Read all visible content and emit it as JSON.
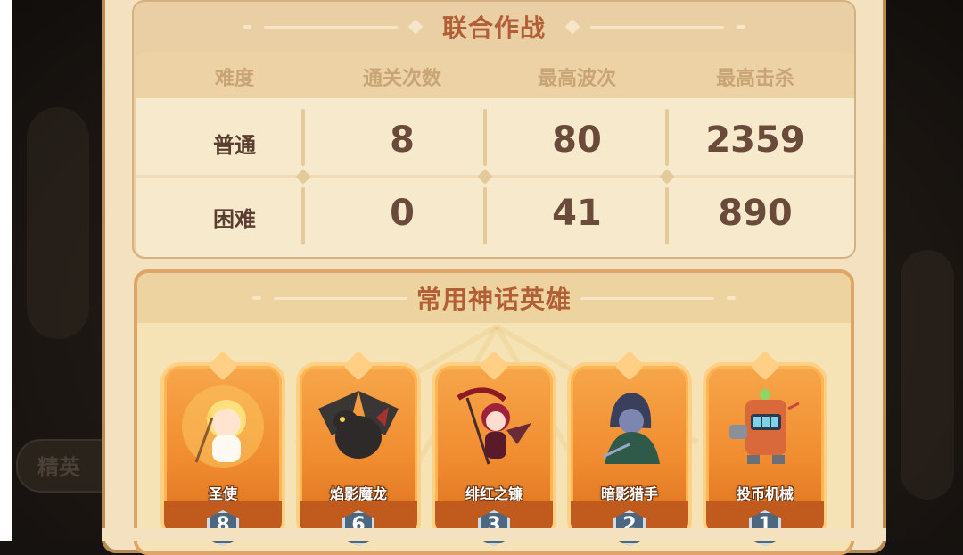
{
  "co_op": {
    "title": "联合作战",
    "headers": [
      "难度",
      "通关次数",
      "最高波次",
      "最高击杀"
    ],
    "rows": [
      {
        "difficulty": "普通",
        "clears": "8",
        "max_wave": "80",
        "max_kills": "2359"
      },
      {
        "difficulty": "困难",
        "clears": "0",
        "max_wave": "41",
        "max_kills": "890"
      }
    ]
  },
  "heroes": {
    "title": "常用神话英雄",
    "items": [
      {
        "name": "圣使",
        "count": "8",
        "icon": "angel-icon"
      },
      {
        "name": "焰影魔龙",
        "count": "6",
        "icon": "dragon-icon"
      },
      {
        "name": "绯红之镰",
        "count": "3",
        "icon": "scythe-demon-icon"
      },
      {
        "name": "暗影猎手",
        "count": "2",
        "icon": "hooded-hunter-icon"
      },
      {
        "name": "投币机械",
        "count": "1",
        "icon": "slot-machine-icon"
      }
    ]
  },
  "colors": {
    "title_red": "#b25e36",
    "stat_text": "#6a4a3a",
    "hero_card_orange": "#f08c2f",
    "badge_blue": "#4e6780"
  }
}
